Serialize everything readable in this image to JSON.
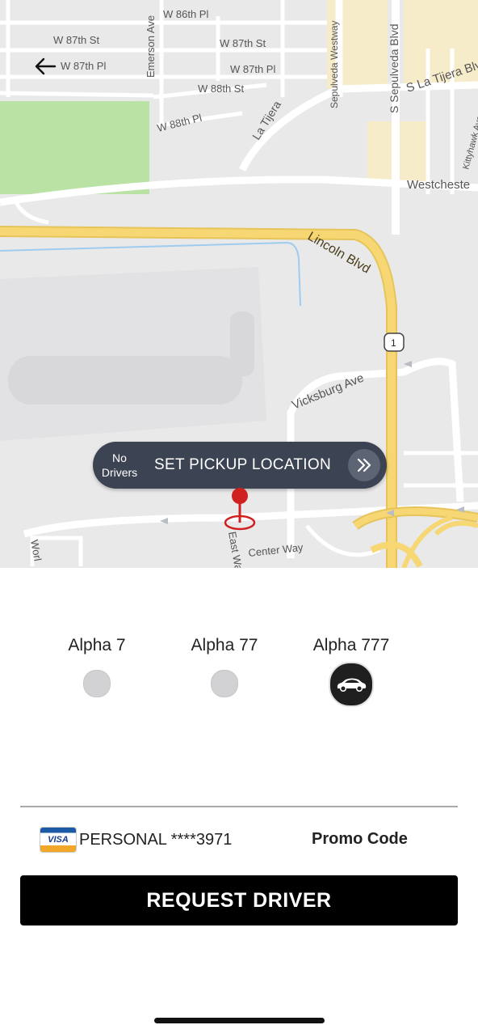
{
  "map": {
    "streets": {
      "w86th_pl": "W 86th Pl",
      "w87th_st_left": "W 87th St",
      "w87th_st_right": "W 87th St",
      "w87th_pl_left": "W 87th Pl",
      "w87th_pl_right": "W 87th Pl",
      "w88th_st": "W 88th St",
      "w88th_pl": "W 88th Pl",
      "emerson_ave": "Emerson Ave",
      "la_tijera": "La Tijera",
      "sepulveda_westway": "Sepulveda Westway",
      "s_sepulveda_blvd": "S Sepulveda Blvd",
      "s_la_tijera_blvd": "S La Tijera Blvd",
      "kittyhawk_ave": "Kittyhawk Ave",
      "westchester": "Westcheste",
      "lincoln_blvd": "Lincoln Blvd",
      "vicksburg_ave": "Vicksburg Ave",
      "route_shield": "1",
      "center_way": "Center Way",
      "east_way": "East Wa",
      "world_way": "Worl"
    },
    "pickup": {
      "status_line1": "No",
      "status_line2": "Drivers",
      "label": "SET PICKUP LOCATION"
    }
  },
  "vehicles": [
    {
      "name": "Alpha 7",
      "selected": false
    },
    {
      "name": "Alpha 77",
      "selected": false
    },
    {
      "name": "Alpha 777",
      "selected": true
    }
  ],
  "payment": {
    "card_brand": "VISA",
    "label": "PERSONAL ****3971"
  },
  "promo": {
    "label": "Promo Code"
  },
  "request": {
    "label": "REQUEST DRIVER"
  },
  "colors": {
    "pill": "#3c4352",
    "button": "#000000",
    "pin": "#d0201f",
    "freeway": "#f7d774",
    "park": "#b9e2a4"
  }
}
